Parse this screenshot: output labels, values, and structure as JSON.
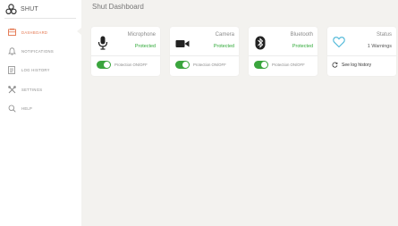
{
  "brand": {
    "name": "SHUT"
  },
  "sidebar": {
    "items": [
      {
        "label": "DASHBOARD",
        "icon": "dashboard-icon",
        "active": true
      },
      {
        "label": "NOTIFICATIONS",
        "icon": "bell-icon",
        "active": false
      },
      {
        "label": "LOG HISTORY",
        "icon": "document-icon",
        "active": false
      },
      {
        "label": "SETTINGS",
        "icon": "wrench-icon",
        "active": false
      },
      {
        "label": "HELP",
        "icon": "search-icon",
        "active": false
      }
    ]
  },
  "header": {
    "title": "Shut Dashboard"
  },
  "cards": [
    {
      "title": "Microphone",
      "status": "Protected",
      "icon": "microphone-icon",
      "toggle_label": "Protection ON/OFF",
      "toggle_on": true
    },
    {
      "title": "Camera",
      "status": "Protected",
      "icon": "camera-icon",
      "toggle_label": "Protection ON/OFF",
      "toggle_on": true
    },
    {
      "title": "Bluetooth",
      "status": "Protected",
      "icon": "bluetooth-icon",
      "toggle_label": "Protection ON/OFF",
      "toggle_on": true
    }
  ],
  "status_card": {
    "title": "Status",
    "warnings": "1 Warnings",
    "icon": "heart-icon",
    "link_label": "See log history"
  },
  "colors": {
    "accent": "#e3734b",
    "protected": "#2ea836",
    "toggle_on": "#3aa53d",
    "heart": "#4fb8d8"
  }
}
